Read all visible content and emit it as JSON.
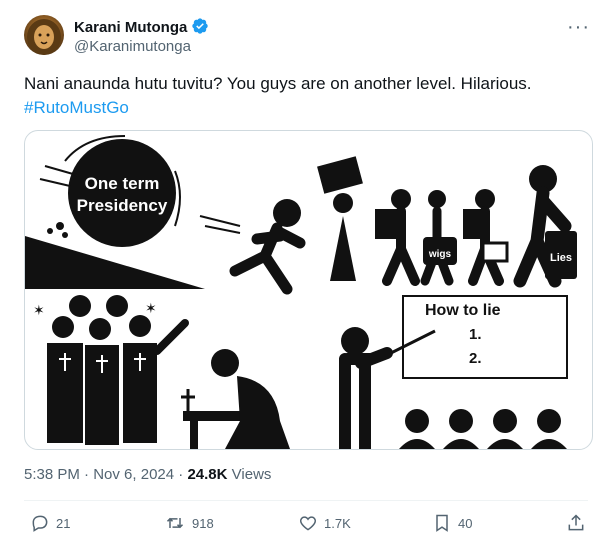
{
  "author": {
    "name": "Karani Mutonga",
    "handle": "@Karanimutonga",
    "verified_color": "#1d9bf0",
    "avatar_icon": "lion-avatar-icon"
  },
  "tweet": {
    "text_line1": "Nani anaunda hutu tuvitu? You guys are on another level.  Hilarious.",
    "hashtag": "#RutoMustGo"
  },
  "media": {
    "panel1": {
      "ball_text_line1": "One term",
      "ball_text_line2": "Presidency"
    },
    "panel2": {
      "bag_label": "wigs",
      "suitcase_label": "Lies"
    },
    "panel4": {
      "board_title": "How to lie",
      "item1": "1.",
      "item2": "2."
    }
  },
  "meta": {
    "time": "5:38 PM",
    "separator": "·",
    "date": "Nov 6, 2024",
    "views_count": "24.8K",
    "views_label": "Views"
  },
  "actions": {
    "replies": "21",
    "reposts": "918",
    "likes": "1.7K",
    "bookmarks": "40"
  },
  "colors": {
    "link": "#1d9bf0",
    "muted": "#536471",
    "text": "#0f1419"
  }
}
